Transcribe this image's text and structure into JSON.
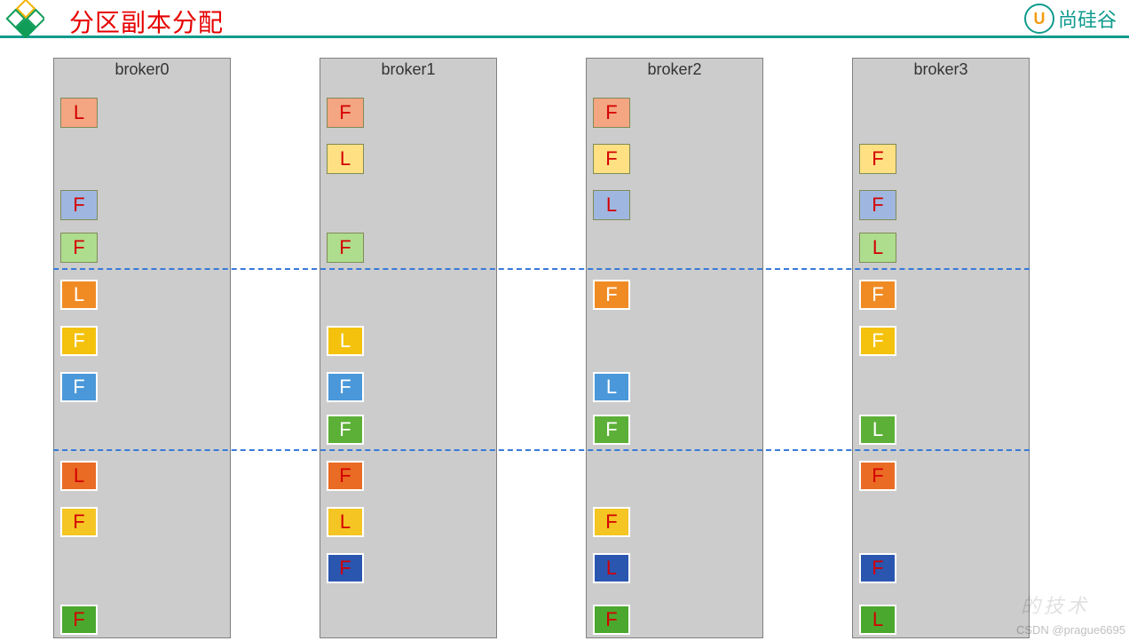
{
  "title": "分区副本分配",
  "brand": {
    "u": "U",
    "name": "尚硅谷"
  },
  "brokers": [
    "broker0",
    "broker1",
    "broker2",
    "broker3"
  ],
  "dividers": [
    1,
    2
  ],
  "partitions": [
    {
      "row": 1,
      "color": "salmon",
      "border": "dark",
      "textWhite": false,
      "cells": {
        "broker0": "L",
        "broker1": "F",
        "broker2": "F"
      }
    },
    {
      "row": 2,
      "color": "lyellow",
      "border": "dark",
      "textWhite": false,
      "cells": {
        "broker1": "L",
        "broker2": "F",
        "broker3": "F"
      }
    },
    {
      "row": 3,
      "color": "lblue",
      "border": "dark",
      "textWhite": false,
      "cells": {
        "broker0": "F",
        "broker2": "L",
        "broker3": "F"
      }
    },
    {
      "row": 4,
      "color": "lgreen",
      "border": "dark",
      "textWhite": false,
      "cells": {
        "broker0": "F",
        "broker1": "F",
        "broker3": "L"
      }
    },
    {
      "row": 5,
      "color": "orange",
      "border": "light",
      "textWhite": true,
      "cells": {
        "broker0": "L",
        "broker2": "F",
        "broker3": "F"
      }
    },
    {
      "row": 6,
      "color": "dyellow",
      "border": "light",
      "textWhite": true,
      "cells": {
        "broker0": "F",
        "broker1": "L",
        "broker3": "F"
      }
    },
    {
      "row": 7,
      "color": "mblue",
      "border": "light",
      "textWhite": true,
      "cells": {
        "broker0": "F",
        "broker1": "F",
        "broker2": "L"
      }
    },
    {
      "row": 8,
      "color": "mgreen",
      "border": "light",
      "textWhite": true,
      "cells": {
        "broker1": "F",
        "broker2": "F",
        "broker3": "L"
      }
    },
    {
      "row": 9,
      "color": "orangeB",
      "border": "light",
      "textWhite": false,
      "cells": {
        "broker0": "L",
        "broker1": "F",
        "broker3": "F"
      }
    },
    {
      "row": 10,
      "color": "yellowB",
      "border": "light",
      "textWhite": false,
      "cells": {
        "broker0": "F",
        "broker1": "L",
        "broker2": "F"
      }
    },
    {
      "row": 11,
      "color": "dblue",
      "border": "light",
      "textWhite": false,
      "cells": {
        "broker1": "F",
        "broker2": "L",
        "broker3": "F"
      }
    },
    {
      "row": 12,
      "color": "dgreen",
      "border": "light",
      "textWhite": false,
      "cells": {
        "broker0": "F",
        "broker2": "F",
        "broker3": "L"
      }
    }
  ],
  "watermark": "CSDN @prague6695",
  "faint": "的技术"
}
